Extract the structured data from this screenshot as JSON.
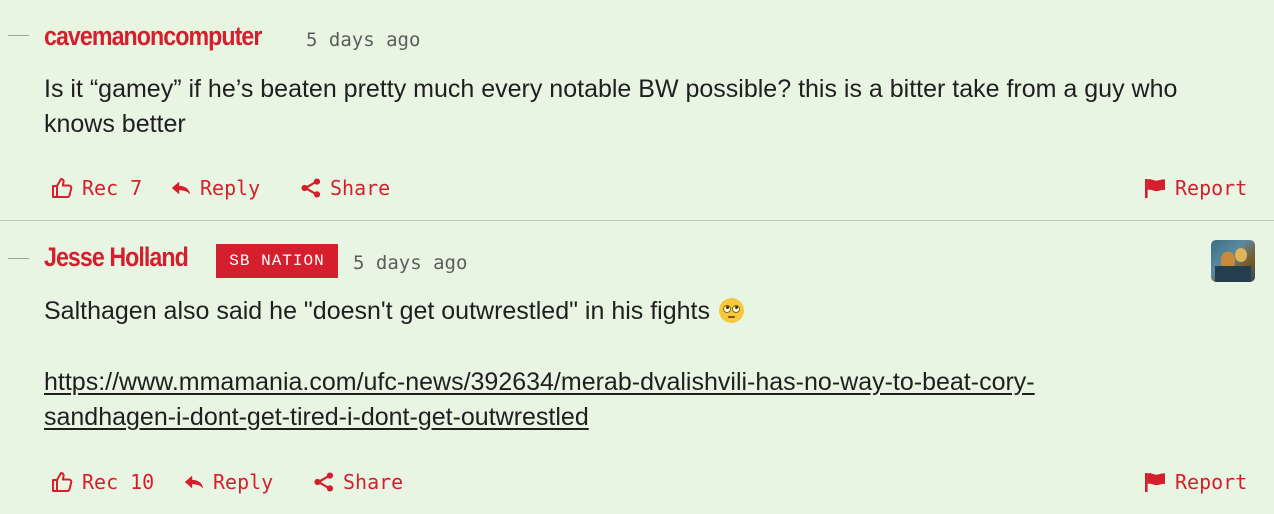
{
  "comments": [
    {
      "author": "cavemanoncomputer",
      "badge": "",
      "timestamp": "5 days ago",
      "body": "Is it “gamey” if he’s beaten pretty much every notable BW possible? this is a bitter take from a guy who knows better",
      "actions": {
        "rec_label": "Rec",
        "rec_count": "7",
        "reply_label": "Reply",
        "share_label": "Share",
        "report_label": "Report"
      }
    },
    {
      "author": "Jesse Holland",
      "badge": "SB NATION",
      "timestamp": "5 days ago",
      "body": "Salthagen also said he \"doesn't get outwrestled\" in his fights",
      "emoji": "face-with-rolling-eyes",
      "link": "https://www.mmamania.com/ufc-news/392634/merab-dvalishvili-has-no-way-to-beat-cory-sandhagen-i-dont-get-tired-i-dont-get-outwrestled",
      "link_line1": "https://www.mmamania.com/ufc-news/392634/merab-dvalishvili-has-no-way-to-beat-cory-",
      "link_line2": "sandhagen-i-dont-get-tired-i-dont-get-outwrestled",
      "actions": {
        "rec_label": "Rec",
        "rec_count": "10",
        "reply_label": "Reply",
        "share_label": "Share",
        "report_label": "Report"
      }
    }
  ],
  "icons": {
    "rec": "thumbs-up-icon",
    "reply": "reply-arrow-icon",
    "share": "share-icon",
    "report": "flag-icon"
  },
  "colors": {
    "background": "#e8f5e3",
    "accent": "#d51f2d",
    "text": "#1f1f1f",
    "muted": "#5c5c5c",
    "divider": "#b9c7b4"
  }
}
